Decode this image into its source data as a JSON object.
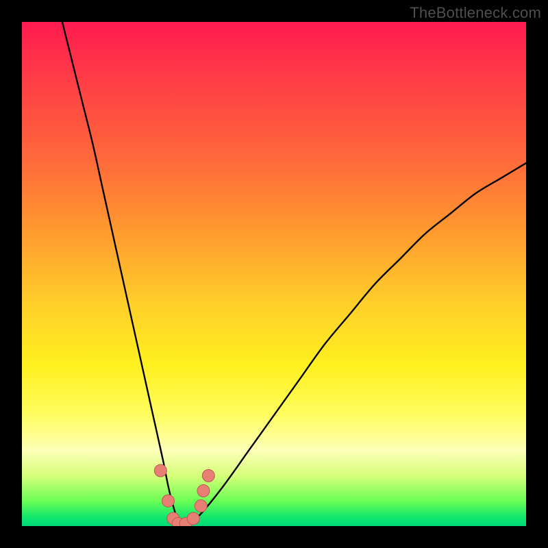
{
  "watermark": "TheBottleneck.com",
  "colors": {
    "curve_stroke": "#000000",
    "marker_fill": "#e77f74",
    "marker_stroke": "#b85a52"
  },
  "chart_data": {
    "type": "line",
    "title": "",
    "xlabel": "",
    "ylabel": "",
    "xlim": [
      0,
      100
    ],
    "ylim": [
      0,
      100
    ],
    "series": [
      {
        "name": "curve",
        "x": [
          8,
          10,
          12,
          14,
          16,
          18,
          20,
          22,
          24,
          26,
          28,
          29,
          30,
          31,
          32,
          33,
          34,
          36,
          40,
          45,
          50,
          55,
          60,
          65,
          70,
          75,
          80,
          85,
          90,
          95,
          100
        ],
        "y": [
          100,
          92,
          84,
          76,
          67,
          58,
          49,
          40,
          31,
          22,
          13,
          8,
          4,
          1,
          0,
          0,
          1,
          3,
          8,
          15,
          22,
          29,
          36,
          42,
          48,
          53,
          58,
          62,
          66,
          69,
          72
        ]
      }
    ],
    "markers": [
      {
        "x": 27.5,
        "y": 11
      },
      {
        "x": 29.0,
        "y": 5
      },
      {
        "x": 30.0,
        "y": 1.5
      },
      {
        "x": 31.0,
        "y": 0.5
      },
      {
        "x": 32.5,
        "y": 0.5
      },
      {
        "x": 34.0,
        "y": 1.5
      },
      {
        "x": 35.5,
        "y": 4
      },
      {
        "x": 36.0,
        "y": 7
      },
      {
        "x": 37.0,
        "y": 10
      }
    ]
  }
}
